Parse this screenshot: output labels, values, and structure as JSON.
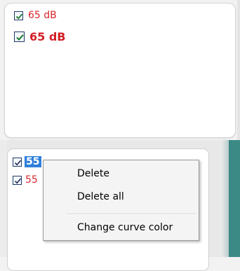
{
  "legend_top": {
    "items": [
      {
        "label": "65 dB",
        "checked": true,
        "style": "normal",
        "color": "#d9262d"
      },
      {
        "label": "65 dB",
        "checked": true,
        "style": "bold",
        "color": "#d31f26"
      }
    ]
  },
  "legend_bottom": {
    "items": [
      {
        "label_visible": "55",
        "selected": true,
        "checked": true
      },
      {
        "label_visible": "55",
        "selected": false,
        "checked": true,
        "color": "#d9262d"
      }
    ]
  },
  "context_menu": {
    "items": [
      {
        "label": "Delete"
      },
      {
        "label": "Delete all"
      },
      {
        "label": "Change curve color"
      }
    ]
  },
  "colors": {
    "selection": "#2f7fdc",
    "accent_strip": "#3c8a86"
  }
}
